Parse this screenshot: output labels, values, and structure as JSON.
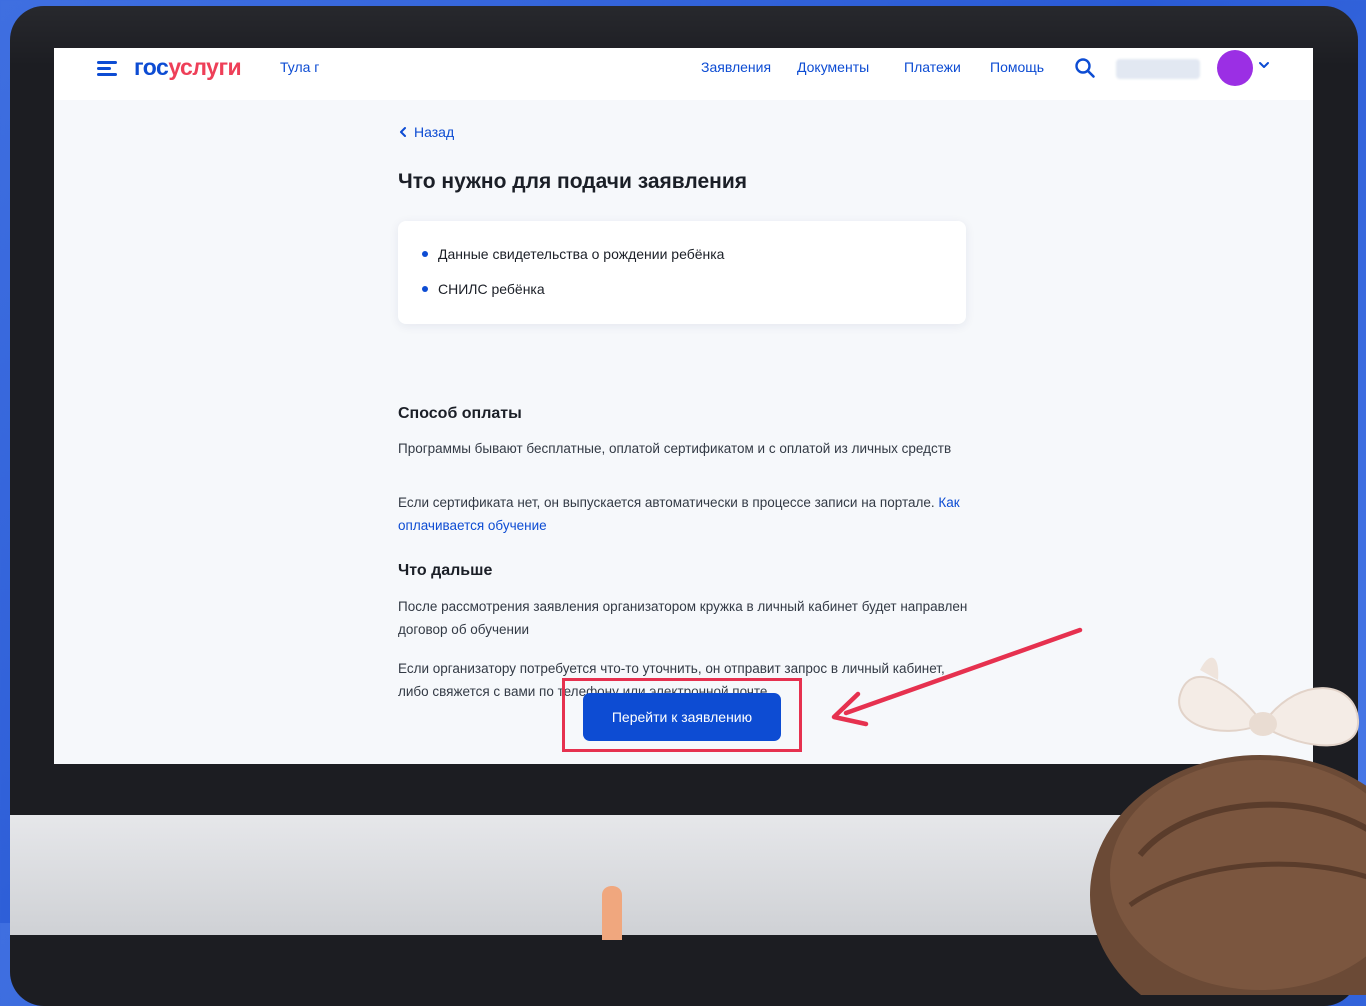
{
  "header": {
    "logo_part1": "гос",
    "logo_part2": "услуги",
    "region": "Тула г",
    "nav": [
      "Заявления",
      "Документы",
      "Платежи",
      "Помощь"
    ]
  },
  "content": {
    "back_label": "Назад",
    "title": "Что нужно для подачи заявления",
    "requirements": [
      "Данные свидетельства о рождении ребёнка",
      "СНИЛС ребёнка"
    ],
    "payment": {
      "heading": "Способ оплаты",
      "p1": "Программы бывают бесплатные, оплатой сертификатом и с оплатой из личных средств",
      "p2": "Если сертификата нет, он выпускается автоматически в процессе записи на портале.",
      "link": "Как оплачивается обучение"
    },
    "next": {
      "heading": "Что дальше",
      "p1": "После рассмотрения заявления организатором кружка в личный кабинет будет направлен договор об обучении",
      "p2": "Если организатору потребуется что-то уточнить, он отправит запрос в личный кабинет, либо свяжется с вами по телефону или электронной почте"
    },
    "cta_label": "Перейти к заявлению"
  },
  "colors": {
    "brand_blue": "#0d4cd3",
    "brand_red": "#ee3f58",
    "avatar": "#9b2fe4",
    "highlight": "#e6314f"
  },
  "icons": [
    "menu-icon",
    "search-icon",
    "chevron-down-icon",
    "chevron-left-icon"
  ]
}
